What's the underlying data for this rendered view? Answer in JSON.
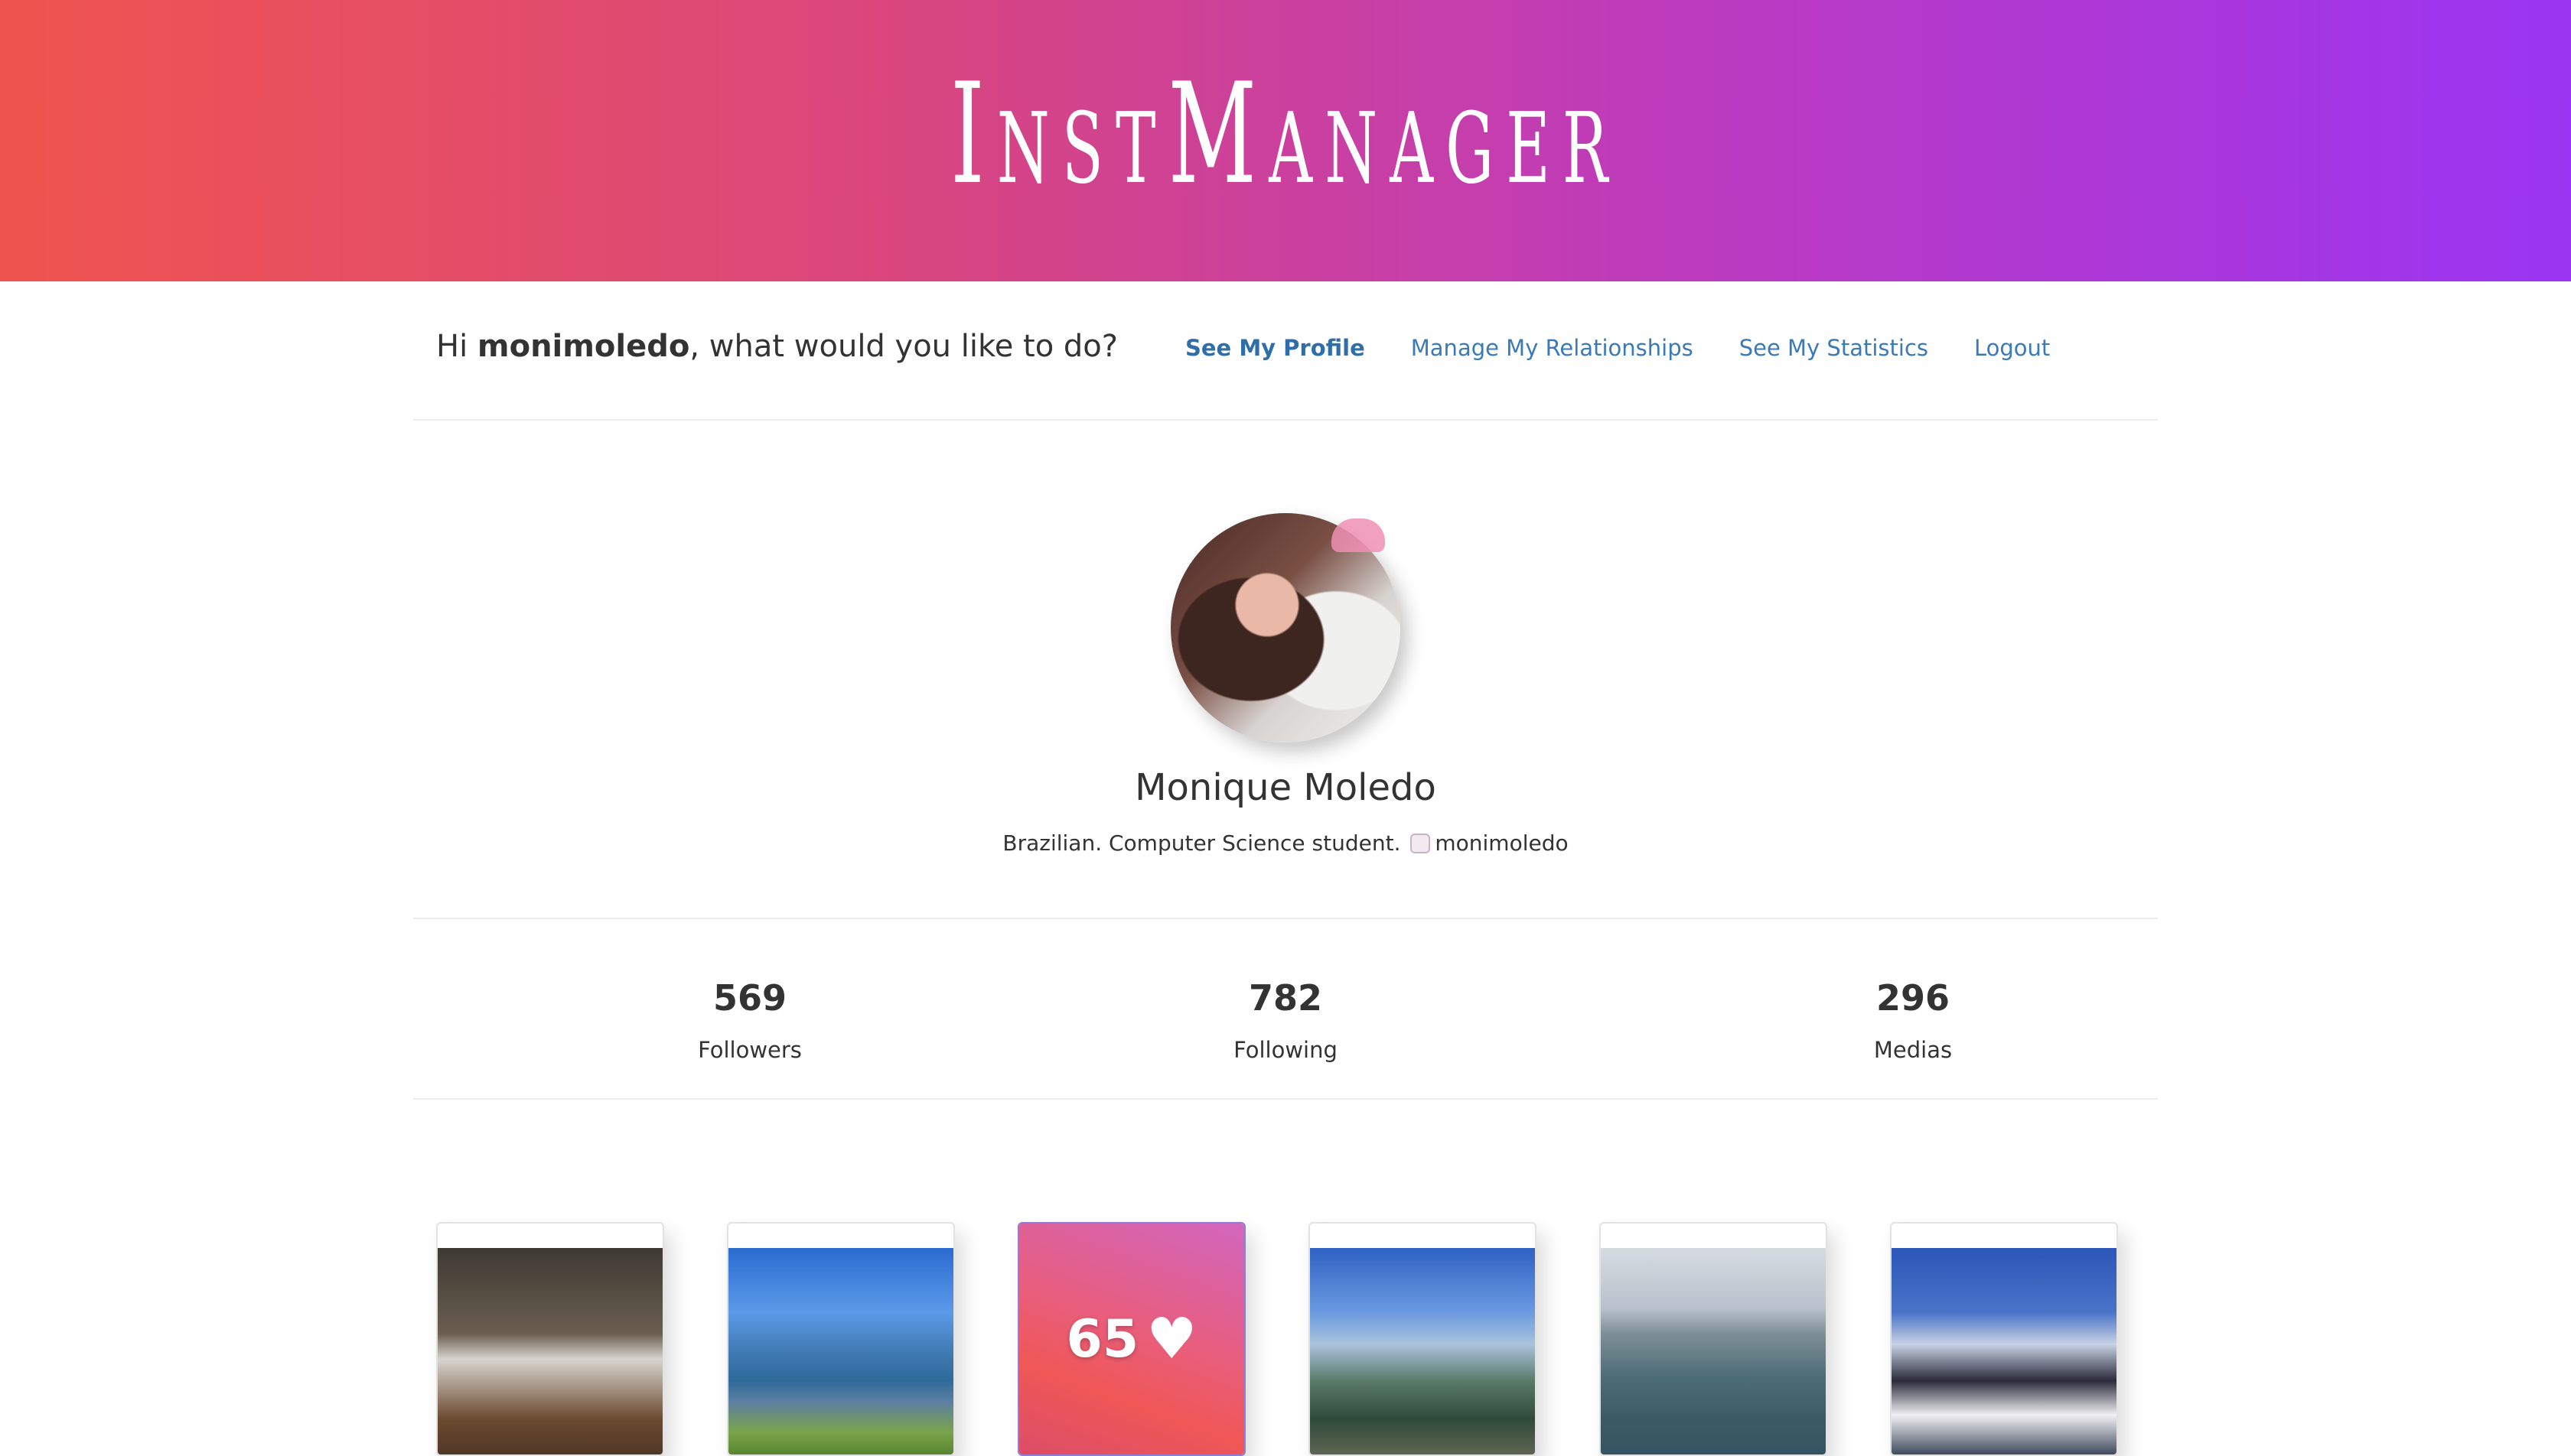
{
  "header": {
    "brand": "InstManager"
  },
  "nav": {
    "greeting_prefix": "Hi ",
    "username": "monimoledo",
    "greeting_suffix": ", what would you like to do?",
    "links": [
      {
        "label": "See My Profile",
        "active": true
      },
      {
        "label": "Manage My Relationships",
        "active": false
      },
      {
        "label": "See My Statistics",
        "active": false
      },
      {
        "label": "Logout",
        "active": false
      }
    ]
  },
  "profile": {
    "name": "Monique Moledo",
    "bio_text": "Brazilian. Computer Science student.",
    "bio_icon": "snapchat-ghost-icon",
    "bio_handle": "monimoledo"
  },
  "stats": [
    {
      "value": "569",
      "label": "Followers"
    },
    {
      "value": "782",
      "label": "Following"
    },
    {
      "value": "296",
      "label": "Medias"
    }
  ],
  "gallery": {
    "hovered_likes": "65",
    "like_icon": "heart-icon",
    "accent_colors": {
      "banner_start": "#f0544f",
      "banner_end": "#9b35f3",
      "link": "#3a7ab7"
    }
  }
}
